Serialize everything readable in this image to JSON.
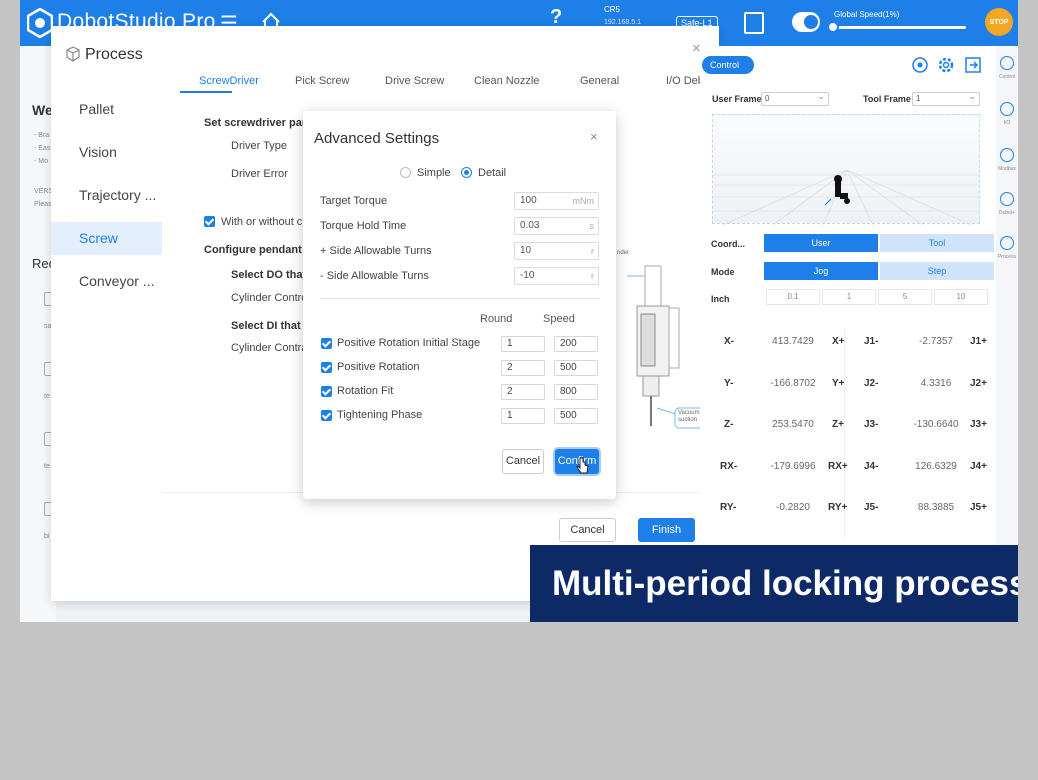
{
  "app": {
    "title": "DobotStudio Pro",
    "robot_name": "CR5",
    "robot_ip": "192.168.5.1",
    "safe_state": "Safe-L1",
    "global_speed_label": "Global Speed(1%)",
    "global_speed_value": 0.01,
    "stop_label": "STOP"
  },
  "background_page": {
    "heading": "We",
    "lines": [
      "- Bra",
      "- Eas",
      "- Mo"
    ],
    "version": "VERSI",
    "please": "Please",
    "recent": "Rec",
    "item_labels": [
      "sa",
      "te",
      "te",
      "bi"
    ]
  },
  "process": {
    "title": "Process",
    "nav": [
      "Pallet",
      "Vision",
      "Trajectory ...",
      "Screw",
      "Conveyor ..."
    ],
    "active_nav": "Screw",
    "tabs": [
      "ScrewDriver",
      "Pick Screw",
      "Drive Screw",
      "Clean Nozzle",
      "General",
      "I/O Debug"
    ],
    "active_tab": "ScrewDriver",
    "body": {
      "section1": "Set screwdriver para",
      "driver_type": "Driver Type",
      "driver_error": "Driver Error",
      "with_or_without": "With or without c",
      "configure_pendant": "Configure pendant t",
      "select_do": "Select DO that",
      "cylinder_control_1": "Cylinder Contro",
      "select_di": "Select DI that i",
      "cylinder_control_2": "Cylinder Contra"
    },
    "diagram_labels": [
      "nder",
      "Vacuum suction"
    ],
    "cancel_label": "Cancel",
    "finish_label": "Finish"
  },
  "dialog": {
    "title": "Advanced Settings",
    "close": "×",
    "modes": [
      "Simple",
      "Detail"
    ],
    "selected_mode": "Detail",
    "fields": [
      {
        "label": "Target Torque",
        "value": "100",
        "unit": "mNm"
      },
      {
        "label": "Torque Hold Time",
        "value": "0.03",
        "unit": "s"
      },
      {
        "label": "+ Side Allowable Turns",
        "value": "10",
        "unit": "r"
      },
      {
        "label": "- Side Allowable Turns",
        "value": "-10",
        "unit": "r"
      }
    ],
    "col_round": "Round",
    "col_speed": "Speed",
    "stages": [
      {
        "label": "Positive Rotation Initial Stage",
        "round": "1",
        "speed": "200",
        "checked": true
      },
      {
        "label": "Positive Rotation",
        "round": "2",
        "speed": "500",
        "checked": true
      },
      {
        "label": "Rotation Fit",
        "round": "2",
        "speed": "800",
        "checked": true
      },
      {
        "label": "Tightening Phase",
        "round": "1",
        "speed": "500",
        "checked": true
      }
    ],
    "cancel_label": "Cancel",
    "confirm_label": "Confirm"
  },
  "control": {
    "tab_label": "Control",
    "user_frame_label": "User Frame",
    "user_frame_value": "0",
    "tool_frame_label": "Tool Frame",
    "tool_frame_value": "1",
    "coord_label": "Coord...",
    "coord_options": [
      "User",
      "Tool"
    ],
    "coord_selected": "User",
    "mode_label": "Mode",
    "mode_options": [
      "Jog",
      "Step"
    ],
    "mode_selected": "Jog",
    "inch_label": "Inch",
    "inch_values": [
      "0.1",
      "1",
      "5",
      "10"
    ],
    "cartesian": [
      {
        "minus": "X-",
        "value": "413.7429",
        "plus": "X+"
      },
      {
        "minus": "Y-",
        "value": "-166.8702",
        "plus": "Y+"
      },
      {
        "minus": "Z-",
        "value": "253.5470",
        "plus": "Z+"
      },
      {
        "minus": "RX-",
        "value": "-179.6996",
        "plus": "RX+"
      },
      {
        "minus": "RY-",
        "value": "-0.2820",
        "plus": "RY+"
      }
    ],
    "joints": [
      {
        "minus": "J1-",
        "value": "-2.7357",
        "plus": "J1+"
      },
      {
        "minus": "J2-",
        "value": "4.3316",
        "plus": "J2+"
      },
      {
        "minus": "J3-",
        "value": "-130.6640",
        "plus": "J3+"
      },
      {
        "minus": "J4-",
        "value": "126.6329",
        "plus": "J4+"
      },
      {
        "minus": "J5-",
        "value": "88.3885",
        "plus": "J5+"
      }
    ]
  },
  "rail": [
    "Control",
    "I/O",
    "Modbus",
    "Dobot+",
    "Process"
  ],
  "caption": "Multi-period locking process",
  "colors": {
    "primary": "#1e7fe8",
    "stop": "#f5a623",
    "caption_bg": "#0e2a66"
  }
}
